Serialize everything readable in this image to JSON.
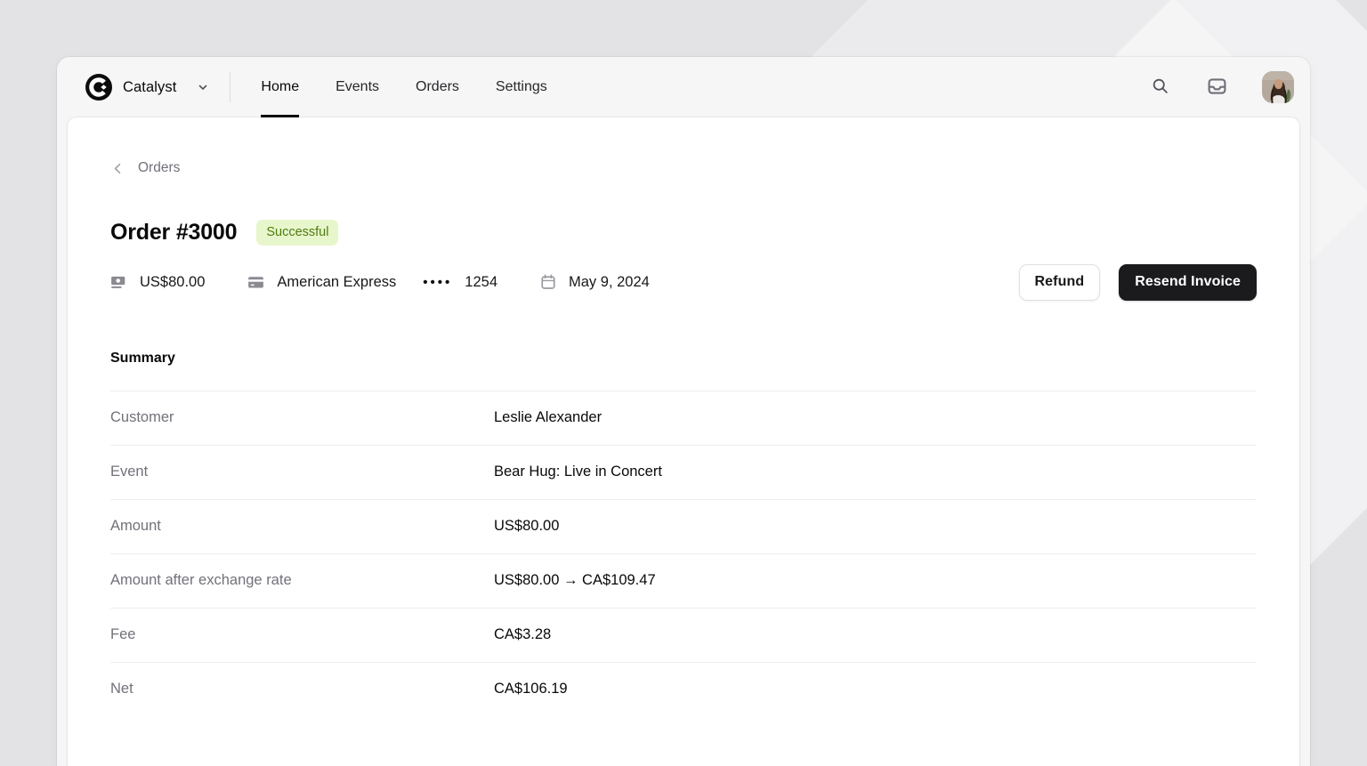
{
  "brand": {
    "name": "Catalyst"
  },
  "nav": {
    "items": [
      {
        "id": "home",
        "label": "Home",
        "active": true
      },
      {
        "id": "events",
        "label": "Events",
        "active": false
      },
      {
        "id": "orders",
        "label": "Orders",
        "active": false
      },
      {
        "id": "settings",
        "label": "Settings",
        "active": false
      }
    ]
  },
  "header_icons": {
    "search": "search-icon",
    "inbox": "inbox-icon",
    "avatar": "user-photo"
  },
  "breadcrumb": {
    "label": "Orders"
  },
  "order": {
    "title": "Order #3000",
    "status": "Successful",
    "amount": "US$80.00",
    "card_brand": "American Express",
    "card_dots": "••••",
    "card_last4": "1254",
    "date": "May 9, 2024"
  },
  "actions": {
    "refund_label": "Refund",
    "resend_label": "Resend Invoice"
  },
  "summary": {
    "heading": "Summary",
    "rows": [
      {
        "label": "Customer",
        "value": "Leslie Alexander"
      },
      {
        "label": "Event",
        "value": "Bear Hug: Live in Concert"
      },
      {
        "label": "Amount",
        "value": "US$80.00"
      },
      {
        "label": "Amount after exchange rate",
        "value": "US$80.00 → CA$109.47"
      },
      {
        "label": "Fee",
        "value": "CA$3.28"
      },
      {
        "label": "Net",
        "value": "CA$106.19"
      }
    ]
  },
  "colors": {
    "status_badge_bg": "#e8f6cb",
    "status_badge_text": "#4d7c0f",
    "primary_button_bg": "#18181b",
    "page_bg": "#e3e3e6",
    "panel_bg": "#ffffff"
  }
}
